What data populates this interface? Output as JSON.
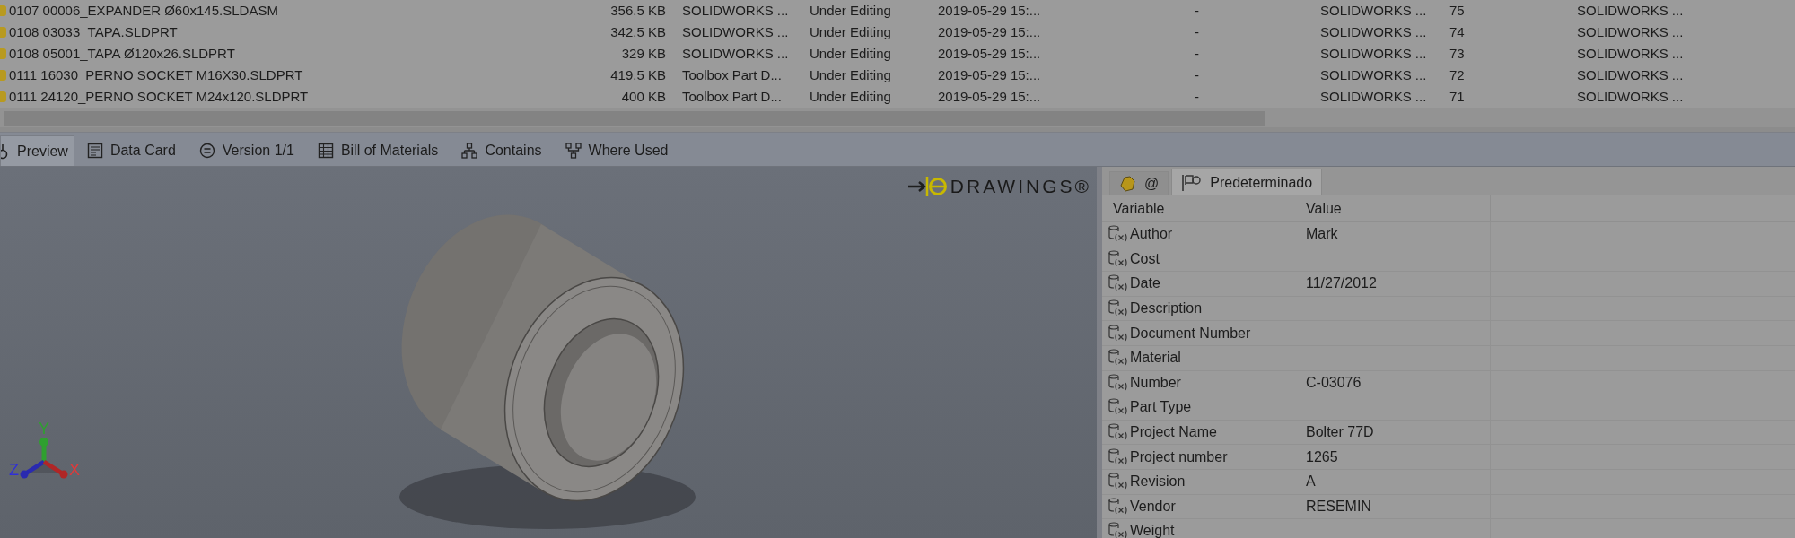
{
  "file_table": {
    "rows": [
      {
        "name": "0107 00006_EXPANDER Ø60x145.SLDASM",
        "size": "356.5 KB",
        "type": "SOLIDWORKS ...",
        "state": "Under Editing",
        "date": "2019-05-29 15:...",
        "column_6": "-",
        "column_7": "SOLIDWORKS ...",
        "column_8": "75",
        "column_9": "SOLIDWORKS ..."
      },
      {
        "name": "0108 03033_TAPA.SLDPRT",
        "size": "342.5 KB",
        "type": "SOLIDWORKS ...",
        "state": "Under Editing",
        "date": "2019-05-29 15:...",
        "column_6": "-",
        "column_7": "SOLIDWORKS ...",
        "column_8": "74",
        "column_9": "SOLIDWORKS ..."
      },
      {
        "name": "0108 05001_TAPA Ø120x26.SLDPRT",
        "size": "329 KB",
        "type": "SOLIDWORKS ...",
        "state": "Under Editing",
        "date": "2019-05-29 15:...",
        "column_6": "-",
        "column_7": "SOLIDWORKS ...",
        "column_8": "73",
        "column_9": "SOLIDWORKS ..."
      },
      {
        "name": "0111 16030_PERNO SOCKET M16X30.SLDPRT",
        "size": "419.5 KB",
        "type": "Toolbox Part D...",
        "state": "Under Editing",
        "date": "2019-05-29 15:...",
        "column_6": "-",
        "column_7": "SOLIDWORKS ...",
        "column_8": "72",
        "column_9": "SOLIDWORKS ..."
      },
      {
        "name": "0111 24120_PERNO SOCKET M24x120.SLDPRT",
        "size": "400 KB",
        "type": "Toolbox Part D...",
        "state": "Under Editing",
        "date": "2019-05-29 15:...",
        "column_6": "-",
        "column_7": "SOLIDWORKS ...",
        "column_8": "71",
        "column_9": "SOLIDWORKS ..."
      }
    ]
  },
  "tabs": [
    {
      "label": "Preview",
      "selected": true
    },
    {
      "label": "Data Card",
      "selected": false
    },
    {
      "label": "Version 1/1",
      "selected": false
    },
    {
      "label": "Bill of Materials",
      "selected": false
    },
    {
      "label": "Contains",
      "selected": false
    },
    {
      "label": "Where Used",
      "selected": false
    }
  ],
  "preview": {
    "logo_text": "DRAWINGS®",
    "axis_labels": {
      "x": "X",
      "y": "Y",
      "z": "Z"
    }
  },
  "variables_panel": {
    "tabs": [
      {
        "label": "@",
        "selected": false
      },
      {
        "label": "Predeterminado",
        "selected": true
      }
    ],
    "columns": [
      "Variable",
      "Value"
    ],
    "rows": [
      {
        "variable": "Author",
        "value": "Mark"
      },
      {
        "variable": "Cost",
        "value": ""
      },
      {
        "variable": "Date",
        "value": "11/27/2012"
      },
      {
        "variable": "Description",
        "value": ""
      },
      {
        "variable": "Document Number",
        "value": ""
      },
      {
        "variable": "Material",
        "value": ""
      },
      {
        "variable": "Number",
        "value": "C-03076"
      },
      {
        "variable": "Part Type",
        "value": ""
      },
      {
        "variable": "Project Name",
        "value": "Bolter 77D"
      },
      {
        "variable": "Project number",
        "value": "1265"
      },
      {
        "variable": "Revision",
        "value": "A"
      },
      {
        "variable": "Vendor",
        "value": "RESEMIN"
      },
      {
        "variable": "Weight",
        "value": ""
      }
    ]
  }
}
